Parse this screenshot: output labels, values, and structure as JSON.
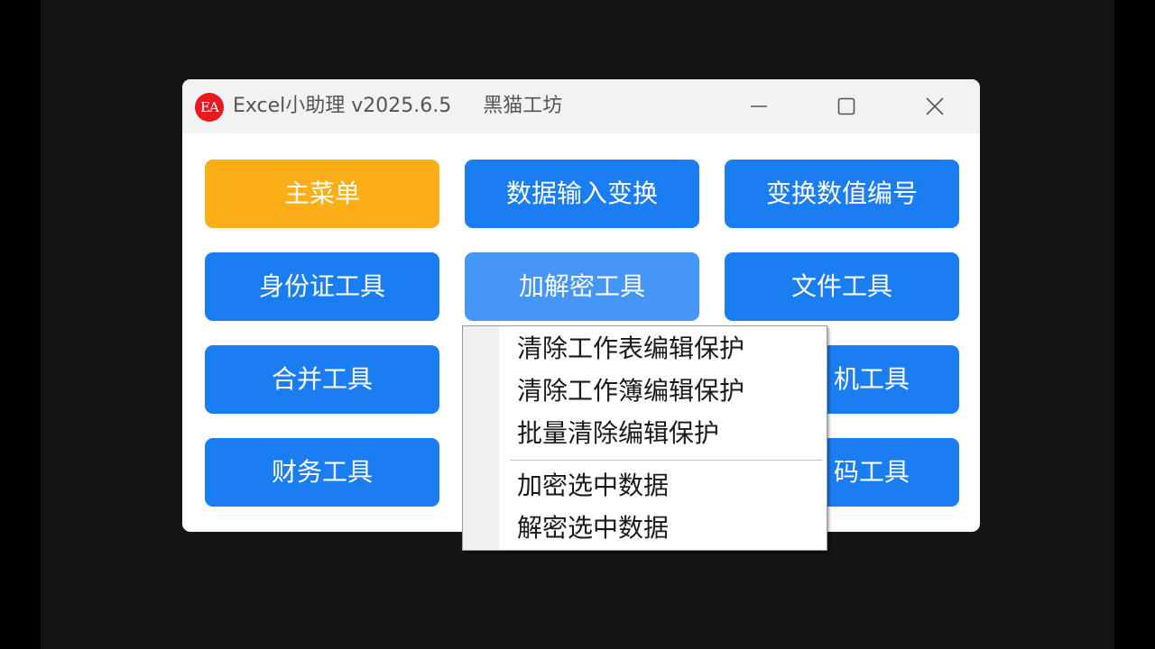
{
  "window": {
    "logo_text": "EA",
    "title": "Excel小助理 v2025.6.5     黑猫工坊",
    "controls": {
      "minimize_icon": "minimize-icon",
      "maximize_icon": "maximize-icon",
      "close_icon": "close-icon"
    }
  },
  "buttons": {
    "main_menu": "主菜单",
    "data_input_transform": "数据输入变换",
    "transform_number_code": "变换数值编号",
    "id_card_tools": "身份证工具",
    "encrypt_decrypt_tools": "加解密工具",
    "file_tools": "文件工具",
    "merge_tools": "合并工具",
    "row3_col3_partial": "机工具",
    "finance_tools": "财务工具",
    "row4_col3_partial": "码工具"
  },
  "context_menu": {
    "items": [
      "清除工作表编辑保护",
      "清除工作簿编辑保护",
      "批量清除编辑保护",
      "加密选中数据",
      "解密选中数据"
    ]
  },
  "colors": {
    "primary_blue": "#1a7df2",
    "hover_blue": "#4596f6",
    "accent_orange": "#fbae17",
    "logo_red": "#e8191f"
  }
}
